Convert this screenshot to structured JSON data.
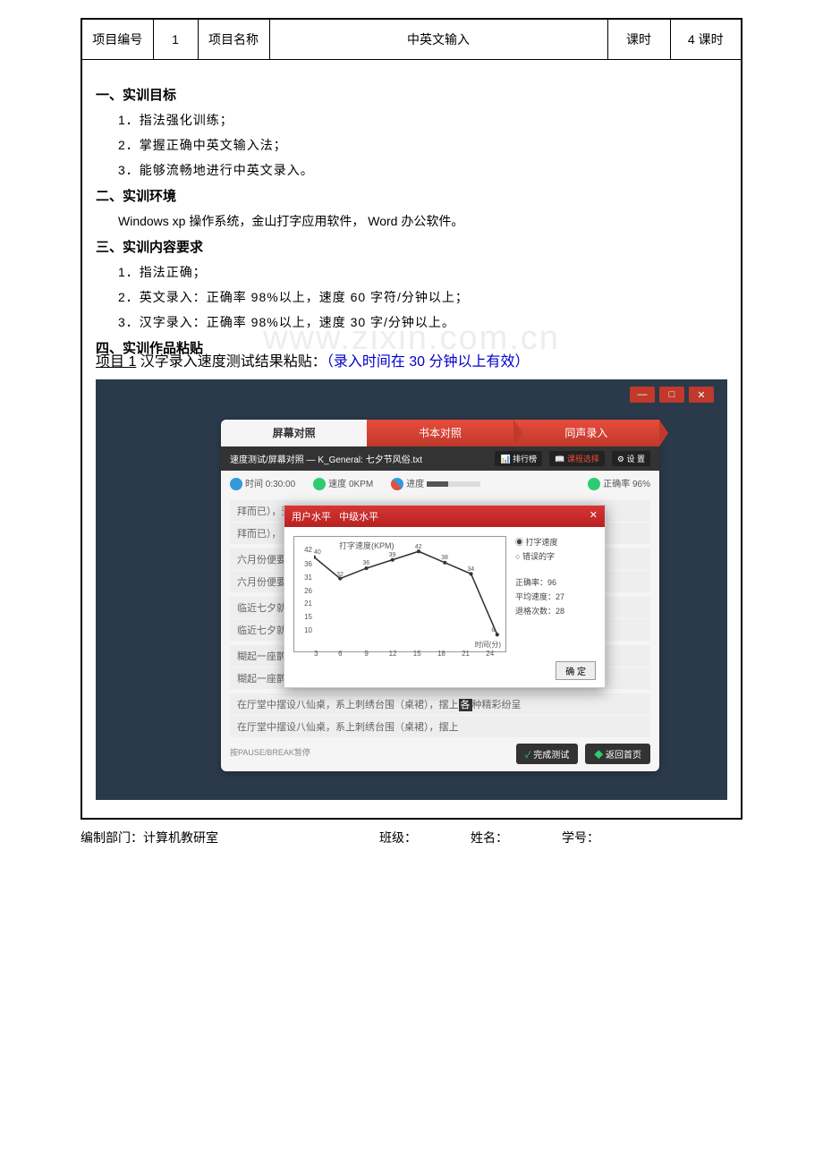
{
  "header": {
    "col1": "项目编号",
    "col2": "1",
    "col3": "项目名称",
    "col4": "中英文输入",
    "col5": "课时",
    "col6": "4 课时"
  },
  "sections": {
    "s1": {
      "title": "一、实训目标",
      "items": [
        "1．指法强化训练；",
        "2．掌握正确中英文输入法；",
        "3．能够流畅地进行中英文录入。"
      ]
    },
    "s2": {
      "title": "二、实训环境",
      "content": "Windows xp 操作系统，金山打字应用软件， Word 办公软件。"
    },
    "s3": {
      "title": "三、实训内容要求",
      "items": [
        "1．指法正确；",
        "2．英文录入：正确率 98%以上，速度 60 字符/分钟以上；",
        "3．汉字录入：正确率 98%以上，速度 30 字/分钟以上。"
      ]
    },
    "s4": {
      "title": "四、实训作品粘贴"
    }
  },
  "project": {
    "label": "项目 1",
    "desc": " 汉字录入速度测试结果粘贴：",
    "note": "（录入时间在 30 分钟以上有效）"
  },
  "watermark": "www.zixin.com.cn",
  "app": {
    "tabs": [
      "屏幕对照",
      "书本对照",
      "同声录入"
    ],
    "breadcrumb": "速度测试/屏幕对照 — K_General: 七夕节风俗.txt",
    "toolbar_btns": [
      "排行榜",
      "课程选择",
      "设 置"
    ],
    "stats": {
      "time_label": "时间",
      "time_val": "0:30:00",
      "speed_label": "速度",
      "speed_val": "0KPM",
      "progress_label": "进度",
      "accuracy_label": "正确率",
      "accuracy_val": "96%"
    },
    "lines": {
      "l1a": "拜而已），预先由要好的七教名姐妹组织起来准备\"拜七姐\"，在",
      "l1b": "拜而已），                                                                                    \"，在",
      "l2a": "六月份便要                                                                                    发芽。",
      "l2b": "六月份便要                                                                                    发芽。",
      "l3a": "临近七夕就                                                                                    篾纸扎",
      "l3b": "临近七夕就                                                                                    篾纸扎",
      "l4a": "糊起一座鹊桥并且制作各种各样的精美手工艺品。到七夕之夜，便",
      "l4b": "糊起一座鹊桥并且制作各种各样的精美手工艺品。到七夕之夜，便",
      "l5a_pre": "在厅堂中摆设八仙桌，系上刺绣台围（桌裙），摆上",
      "l5a_hl": "各",
      "l5a_post": "种精彩纷呈",
      "l5b": "在厅堂中摆设八仙桌，系上刺绣台围（桌裙），摆上"
    },
    "pause": "按PAUSE/BREAK暂停",
    "btn_finish": "完成测试",
    "btn_home": "返回首页"
  },
  "modal": {
    "title_left": "用户水平",
    "title_right": "中级水平",
    "radio1": "打字速度",
    "radio2": "错误的字",
    "stat1": "正确率：96",
    "stat2": "平均速度：27",
    "stat3": "退格次数：28",
    "confirm": "确 定",
    "chart_title": "打字速度(KPM)",
    "x_label": "时间(分)"
  },
  "chart_data": {
    "type": "line",
    "title": "打字速度(KPM)",
    "xlabel": "时间(分)",
    "ylabel": "",
    "x": [
      3,
      6,
      9,
      12,
      15,
      18,
      21,
      24
    ],
    "y": [
      40,
      32,
      36,
      39,
      42,
      38,
      34,
      7
    ],
    "y_ticks": [
      10,
      15,
      21,
      26,
      31,
      36,
      42
    ],
    "data_labels": [
      40,
      32,
      36,
      39,
      42,
      38,
      34,
      8
    ],
    "ylim": [
      5,
      45
    ]
  },
  "footer": {
    "dept": "编制部门：计算机教研室",
    "class": "班级：",
    "name": "姓名：",
    "id": "学号："
  }
}
